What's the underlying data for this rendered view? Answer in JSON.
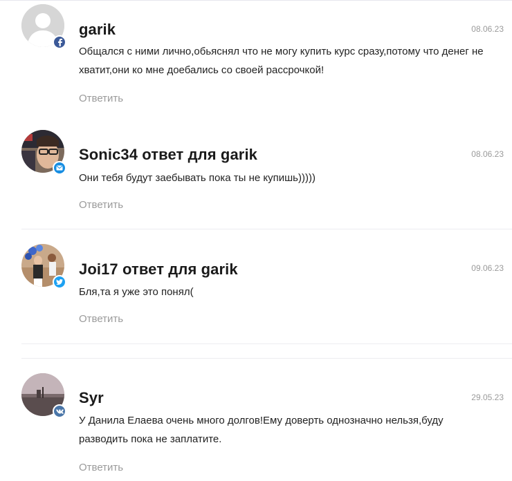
{
  "comments": [
    {
      "author": "garik",
      "date": "08.06.23",
      "text": "Общался с ними лично,обьяснял что не могу купить курс сразу,потому что денег не хватит,они ко мне доебались со своей рассрочкой!",
      "reply_label": "Ответить",
      "avatar_icon": "default-user-avatar",
      "badge_icon": "facebook-icon",
      "badge_color": "#3b5998"
    },
    {
      "author": "Sonic34 ответ для garik",
      "date": "08.06.23",
      "text": "Они тебя будут заебывать пока ты не купишь)))))",
      "reply_label": "Ответить",
      "avatar_icon": "user-photo-avatar",
      "badge_icon": "mail-icon",
      "badge_color": "#168de2"
    },
    {
      "author": "Joi17 ответ для garik",
      "date": "09.06.23",
      "text": "Бля,та я уже это понял(",
      "reply_label": "Ответить",
      "avatar_icon": "user-photo-avatar",
      "badge_icon": "twitter-icon",
      "badge_color": "#1da1f2"
    },
    {
      "author": "Syr",
      "date": "29.05.23",
      "text": "У Данила Елаева очень много долгов!Ему доверть однозначно нельзя,буду разводить пока не заплатите.",
      "reply_label": "Ответить",
      "avatar_icon": "user-photo-avatar",
      "badge_icon": "vk-icon",
      "badge_color": "#4a76a8"
    }
  ]
}
